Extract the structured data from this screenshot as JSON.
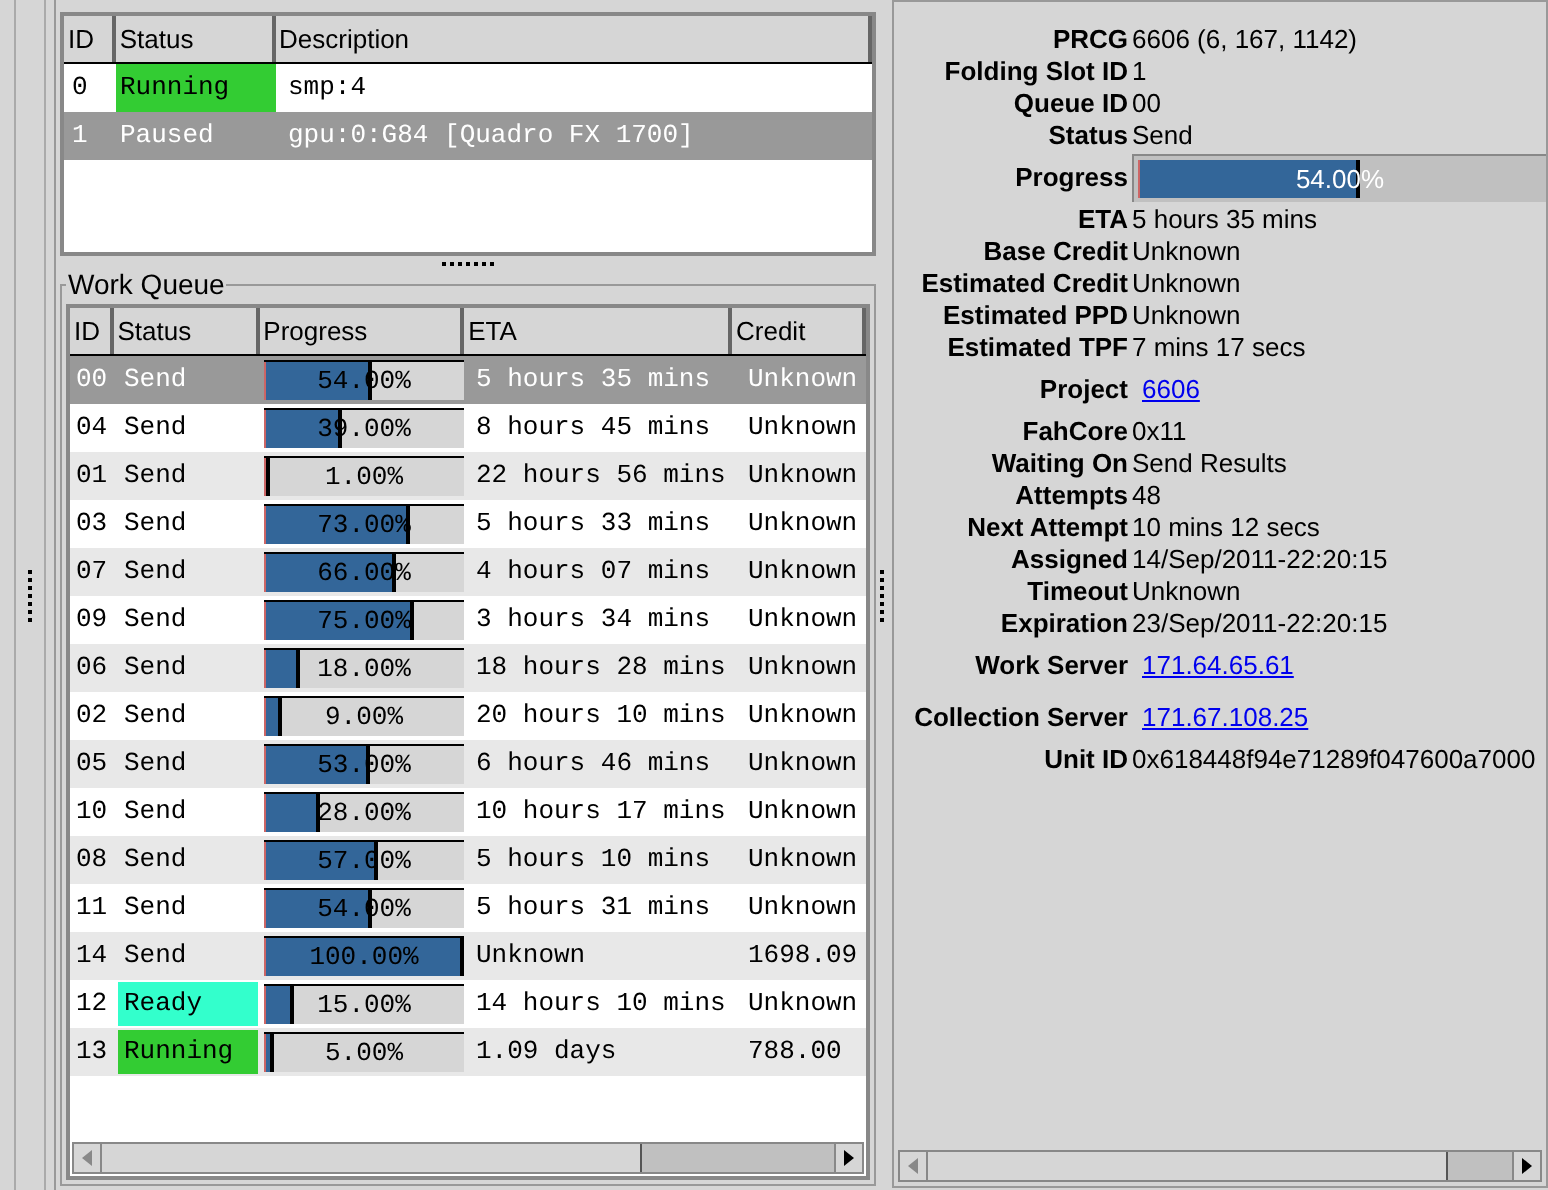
{
  "folding_slots": {
    "columns": [
      "ID",
      "Status",
      "Description"
    ],
    "rows": [
      {
        "id": "0",
        "status": "Running",
        "kind": "running",
        "description": "smp:4",
        "selected": false
      },
      {
        "id": "1",
        "status": "Paused",
        "kind": "paused",
        "description": "gpu:0:G84 [Quadro FX 1700]",
        "selected": true
      }
    ]
  },
  "work_queue": {
    "title": "Work Queue",
    "columns": [
      "ID",
      "Status",
      "Progress",
      "ETA",
      "Credit"
    ],
    "rows": [
      {
        "id": "00",
        "status": "Send",
        "kind": "send",
        "level": 0.54,
        "progress": "54.00%",
        "eta": "5 hours 35 mins",
        "credit": "Unknown",
        "selected": true
      },
      {
        "id": "04",
        "status": "Send",
        "kind": "send",
        "level": 0.39,
        "progress": "39.00%",
        "eta": "8 hours 45 mins",
        "credit": "Unknown",
        "selected": false
      },
      {
        "id": "01",
        "status": "Send",
        "kind": "send",
        "level": 0.01,
        "progress": "1.00%",
        "eta": "22 hours 56 mins",
        "credit": "Unknown",
        "selected": false
      },
      {
        "id": "03",
        "status": "Send",
        "kind": "send",
        "level": 0.73,
        "progress": "73.00%",
        "eta": "5 hours 33 mins",
        "credit": "Unknown",
        "selected": false
      },
      {
        "id": "07",
        "status": "Send",
        "kind": "send",
        "level": 0.66,
        "progress": "66.00%",
        "eta": "4 hours 07 mins",
        "credit": "Unknown",
        "selected": false
      },
      {
        "id": "09",
        "status": "Send",
        "kind": "send",
        "level": 0.75,
        "progress": "75.00%",
        "eta": "3 hours 34 mins",
        "credit": "Unknown",
        "selected": false
      },
      {
        "id": "06",
        "status": "Send",
        "kind": "send",
        "level": 0.18,
        "progress": "18.00%",
        "eta": "18 hours 28 mins",
        "credit": "Unknown",
        "selected": false
      },
      {
        "id": "02",
        "status": "Send",
        "kind": "send",
        "level": 0.09,
        "progress": "9.00%",
        "eta": "20 hours 10 mins",
        "credit": "Unknown",
        "selected": false
      },
      {
        "id": "05",
        "status": "Send",
        "kind": "send",
        "level": 0.53,
        "progress": "53.00%",
        "eta": "6 hours 46 mins",
        "credit": "Unknown",
        "selected": false
      },
      {
        "id": "10",
        "status": "Send",
        "kind": "send",
        "level": 0.28,
        "progress": "28.00%",
        "eta": "10 hours 17 mins",
        "credit": "Unknown",
        "selected": false
      },
      {
        "id": "08",
        "status": "Send",
        "kind": "send",
        "level": 0.57,
        "progress": "57.00%",
        "eta": "5 hours 10 mins",
        "credit": "Unknown",
        "selected": false
      },
      {
        "id": "11",
        "status": "Send",
        "kind": "send",
        "level": 0.54,
        "progress": "54.00%",
        "eta": "5 hours 31 mins",
        "credit": "Unknown",
        "selected": false
      },
      {
        "id": "14",
        "status": "Send",
        "kind": "send",
        "level": 1.0,
        "progress": "100.00%",
        "eta": "Unknown",
        "credit": "1698.09",
        "selected": false
      },
      {
        "id": "12",
        "status": "Ready",
        "kind": "ready",
        "level": 0.15,
        "progress": "15.00%",
        "eta": "14 hours 10 mins",
        "credit": "Unknown",
        "selected": false
      },
      {
        "id": "13",
        "status": "Running",
        "kind": "running",
        "level": 0.05,
        "progress": "5.00%",
        "eta": "1.09 days",
        "credit": "788.00",
        "selected": false
      }
    ]
  },
  "work_unit": {
    "fields": [
      {
        "kind": "text",
        "label": "PRCG",
        "value": "6606 (6, 167, 1142)"
      },
      {
        "kind": "text",
        "label": "Folding Slot ID",
        "value": "1"
      },
      {
        "kind": "text",
        "label": "Queue ID",
        "value": "00"
      },
      {
        "kind": "text",
        "label": "Status",
        "value": "Send"
      },
      {
        "kind": "progress",
        "label": "Progress",
        "value": "54.00%",
        "level": 0.54
      },
      {
        "kind": "text",
        "label": "ETA",
        "value": "5 hours 35 mins"
      },
      {
        "kind": "text",
        "label": "Base Credit",
        "value": "Unknown"
      },
      {
        "kind": "text",
        "label": "Estimated Credit",
        "value": "Unknown"
      },
      {
        "kind": "text",
        "label": "Estimated PPD",
        "value": "Unknown"
      },
      {
        "kind": "text",
        "label": "Estimated TPF",
        "value": "7 mins 17 secs"
      },
      {
        "kind": "link",
        "label": "Project",
        "value": "6606"
      },
      {
        "kind": "text",
        "label": "FahCore",
        "value": "0x11"
      },
      {
        "kind": "text",
        "label": "Waiting On",
        "value": "Send Results"
      },
      {
        "kind": "text",
        "label": "Attempts",
        "value": "48"
      },
      {
        "kind": "text",
        "label": "Next Attempt",
        "value": "10 mins 12 secs"
      },
      {
        "kind": "text",
        "label": "Assigned",
        "value": "14/Sep/2011-22:20:15"
      },
      {
        "kind": "text",
        "label": "Timeout",
        "value": "Unknown"
      },
      {
        "kind": "text",
        "label": "Expiration",
        "value": "23/Sep/2011-22:20:15"
      },
      {
        "kind": "link",
        "label": "Work Server",
        "value": "171.64.65.61"
      },
      {
        "kind": "link",
        "label": "Collection Server",
        "value": "171.67.108.25"
      },
      {
        "kind": "text",
        "label": "Unit ID",
        "value": "0x618448f94e71289f047600a7000"
      }
    ]
  }
}
